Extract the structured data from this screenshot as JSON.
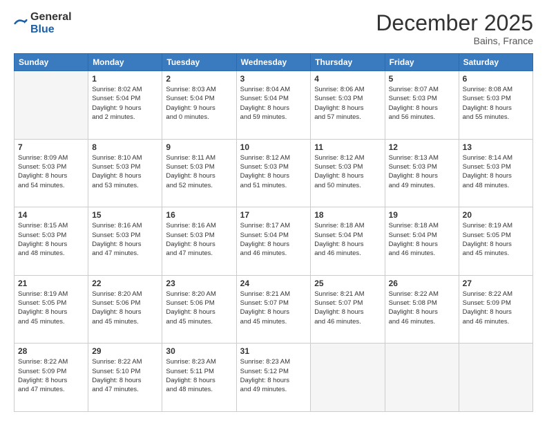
{
  "header": {
    "logo_general": "General",
    "logo_blue": "Blue",
    "month": "December 2025",
    "location": "Bains, France"
  },
  "days_header": [
    "Sunday",
    "Monday",
    "Tuesday",
    "Wednesday",
    "Thursday",
    "Friday",
    "Saturday"
  ],
  "weeks": [
    [
      {
        "num": "",
        "info": ""
      },
      {
        "num": "1",
        "info": "Sunrise: 8:02 AM\nSunset: 5:04 PM\nDaylight: 9 hours\nand 2 minutes."
      },
      {
        "num": "2",
        "info": "Sunrise: 8:03 AM\nSunset: 5:04 PM\nDaylight: 9 hours\nand 0 minutes."
      },
      {
        "num": "3",
        "info": "Sunrise: 8:04 AM\nSunset: 5:04 PM\nDaylight: 8 hours\nand 59 minutes."
      },
      {
        "num": "4",
        "info": "Sunrise: 8:06 AM\nSunset: 5:03 PM\nDaylight: 8 hours\nand 57 minutes."
      },
      {
        "num": "5",
        "info": "Sunrise: 8:07 AM\nSunset: 5:03 PM\nDaylight: 8 hours\nand 56 minutes."
      },
      {
        "num": "6",
        "info": "Sunrise: 8:08 AM\nSunset: 5:03 PM\nDaylight: 8 hours\nand 55 minutes."
      }
    ],
    [
      {
        "num": "7",
        "info": "Sunrise: 8:09 AM\nSunset: 5:03 PM\nDaylight: 8 hours\nand 54 minutes."
      },
      {
        "num": "8",
        "info": "Sunrise: 8:10 AM\nSunset: 5:03 PM\nDaylight: 8 hours\nand 53 minutes."
      },
      {
        "num": "9",
        "info": "Sunrise: 8:11 AM\nSunset: 5:03 PM\nDaylight: 8 hours\nand 52 minutes."
      },
      {
        "num": "10",
        "info": "Sunrise: 8:12 AM\nSunset: 5:03 PM\nDaylight: 8 hours\nand 51 minutes."
      },
      {
        "num": "11",
        "info": "Sunrise: 8:12 AM\nSunset: 5:03 PM\nDaylight: 8 hours\nand 50 minutes."
      },
      {
        "num": "12",
        "info": "Sunrise: 8:13 AM\nSunset: 5:03 PM\nDaylight: 8 hours\nand 49 minutes."
      },
      {
        "num": "13",
        "info": "Sunrise: 8:14 AM\nSunset: 5:03 PM\nDaylight: 8 hours\nand 48 minutes."
      }
    ],
    [
      {
        "num": "14",
        "info": "Sunrise: 8:15 AM\nSunset: 5:03 PM\nDaylight: 8 hours\nand 48 minutes."
      },
      {
        "num": "15",
        "info": "Sunrise: 8:16 AM\nSunset: 5:03 PM\nDaylight: 8 hours\nand 47 minutes."
      },
      {
        "num": "16",
        "info": "Sunrise: 8:16 AM\nSunset: 5:03 PM\nDaylight: 8 hours\nand 47 minutes."
      },
      {
        "num": "17",
        "info": "Sunrise: 8:17 AM\nSunset: 5:04 PM\nDaylight: 8 hours\nand 46 minutes."
      },
      {
        "num": "18",
        "info": "Sunrise: 8:18 AM\nSunset: 5:04 PM\nDaylight: 8 hours\nand 46 minutes."
      },
      {
        "num": "19",
        "info": "Sunrise: 8:18 AM\nSunset: 5:04 PM\nDaylight: 8 hours\nand 46 minutes."
      },
      {
        "num": "20",
        "info": "Sunrise: 8:19 AM\nSunset: 5:05 PM\nDaylight: 8 hours\nand 45 minutes."
      }
    ],
    [
      {
        "num": "21",
        "info": "Sunrise: 8:19 AM\nSunset: 5:05 PM\nDaylight: 8 hours\nand 45 minutes."
      },
      {
        "num": "22",
        "info": "Sunrise: 8:20 AM\nSunset: 5:06 PM\nDaylight: 8 hours\nand 45 minutes."
      },
      {
        "num": "23",
        "info": "Sunrise: 8:20 AM\nSunset: 5:06 PM\nDaylight: 8 hours\nand 45 minutes."
      },
      {
        "num": "24",
        "info": "Sunrise: 8:21 AM\nSunset: 5:07 PM\nDaylight: 8 hours\nand 45 minutes."
      },
      {
        "num": "25",
        "info": "Sunrise: 8:21 AM\nSunset: 5:07 PM\nDaylight: 8 hours\nand 46 minutes."
      },
      {
        "num": "26",
        "info": "Sunrise: 8:22 AM\nSunset: 5:08 PM\nDaylight: 8 hours\nand 46 minutes."
      },
      {
        "num": "27",
        "info": "Sunrise: 8:22 AM\nSunset: 5:09 PM\nDaylight: 8 hours\nand 46 minutes."
      }
    ],
    [
      {
        "num": "28",
        "info": "Sunrise: 8:22 AM\nSunset: 5:09 PM\nDaylight: 8 hours\nand 47 minutes."
      },
      {
        "num": "29",
        "info": "Sunrise: 8:22 AM\nSunset: 5:10 PM\nDaylight: 8 hours\nand 47 minutes."
      },
      {
        "num": "30",
        "info": "Sunrise: 8:23 AM\nSunset: 5:11 PM\nDaylight: 8 hours\nand 48 minutes."
      },
      {
        "num": "31",
        "info": "Sunrise: 8:23 AM\nSunset: 5:12 PM\nDaylight: 8 hours\nand 49 minutes."
      },
      {
        "num": "",
        "info": ""
      },
      {
        "num": "",
        "info": ""
      },
      {
        "num": "",
        "info": ""
      }
    ]
  ]
}
